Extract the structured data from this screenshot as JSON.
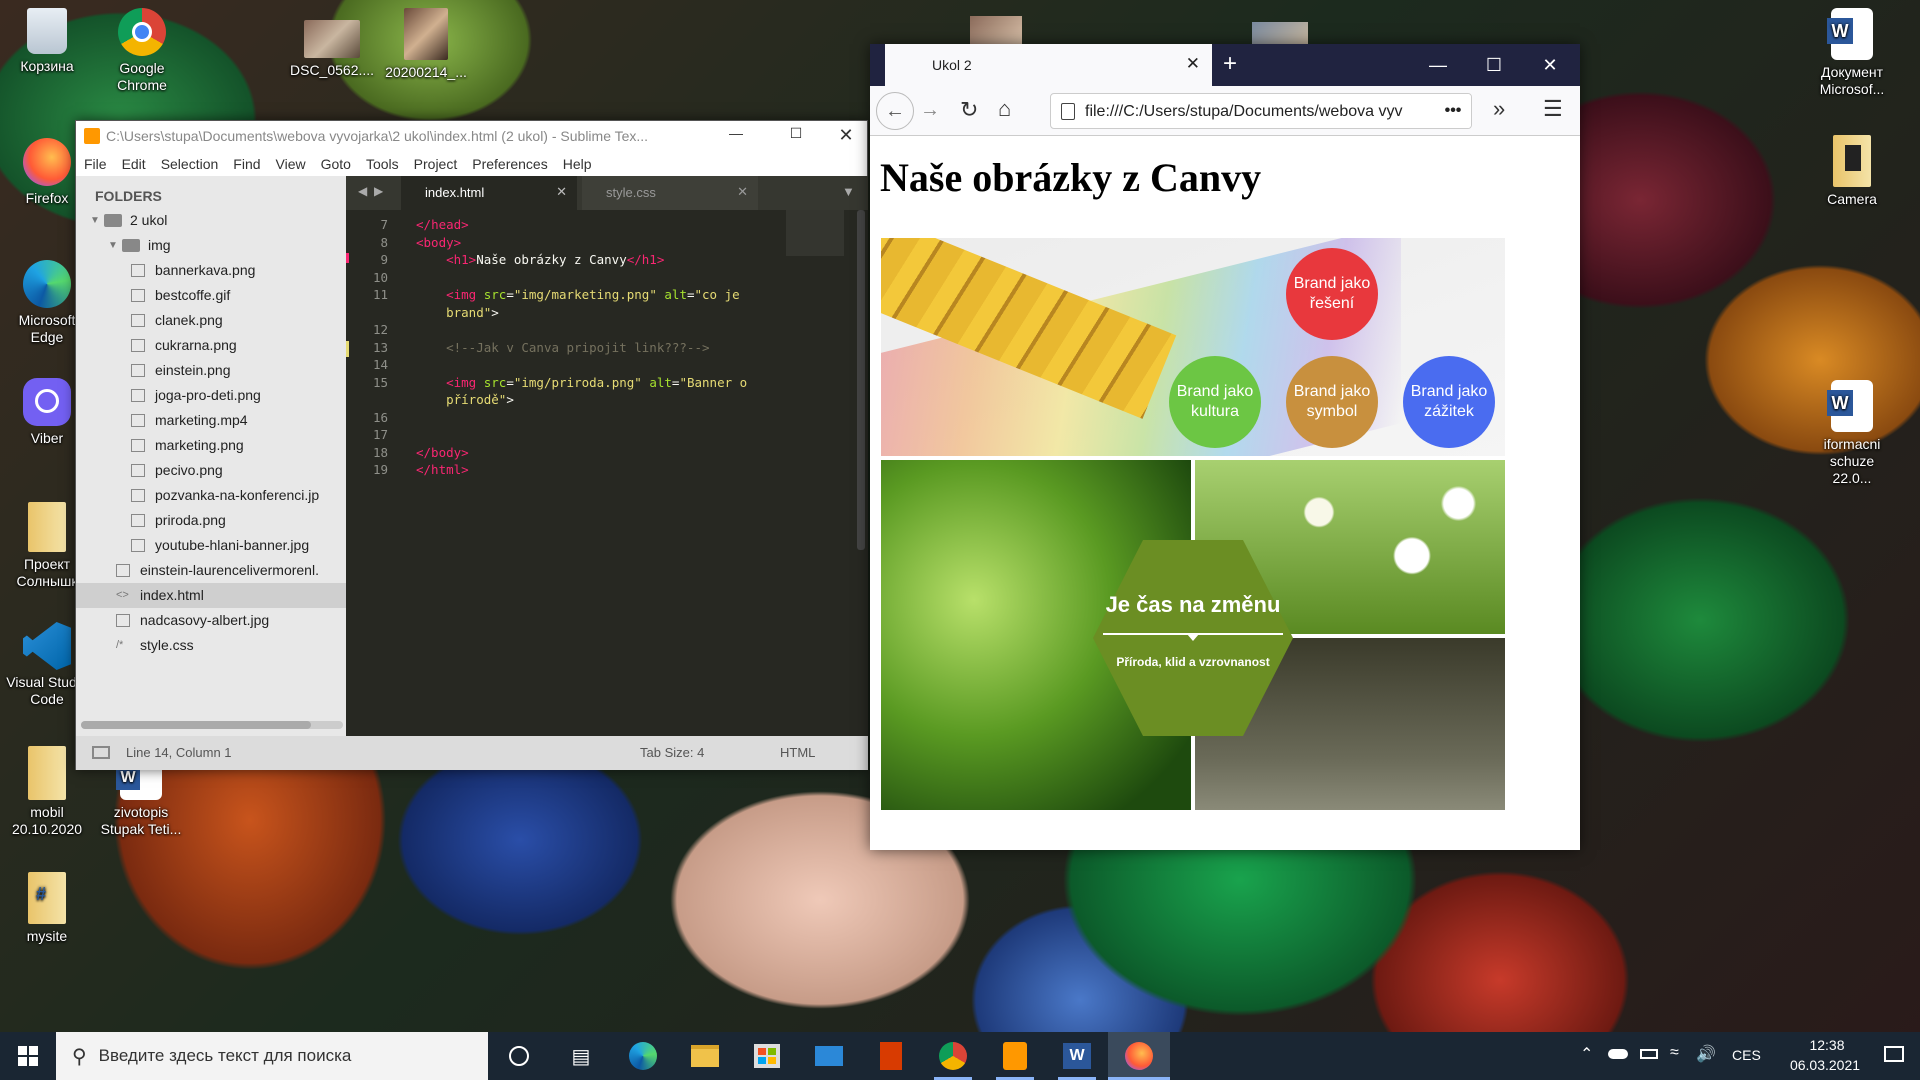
{
  "desktop": {
    "icons": [
      {
        "label": "Корзина",
        "sub": ""
      },
      {
        "label": "Google Chrome",
        "sub": ""
      },
      {
        "label": "DSC_0562....",
        "sub": ""
      },
      {
        "label": "20200214_...",
        "sub": ""
      },
      {
        "label": "Firefox",
        "sub": ""
      },
      {
        "label": "Microsoft Edge",
        "sub": ""
      },
      {
        "label": "Viber",
        "sub": ""
      },
      {
        "label": "Проект Солнышк",
        "sub": ""
      },
      {
        "label": "Visual Studio Code",
        "sub": ""
      },
      {
        "label": "mobil 20.10.2020",
        "sub": ""
      },
      {
        "label": "zivotopis Stupak Teti...",
        "sub": ""
      },
      {
        "label": "mysite",
        "sub": ""
      },
      {
        "label": "Документ Microsof...",
        "sub": ""
      },
      {
        "label": "Camera",
        "sub": ""
      },
      {
        "label": "iformacni schuze 22.0...",
        "sub": ""
      }
    ]
  },
  "sublime": {
    "title": "C:\\Users\\stupa\\Documents\\webova vyvojarka\\2 ukol\\index.html (2 ukol) - Sublime Tex...",
    "menu": [
      "File",
      "Edit",
      "Selection",
      "Find",
      "View",
      "Goto",
      "Tools",
      "Project",
      "Preferences",
      "Help"
    ],
    "folders_header": "FOLDERS",
    "tree": [
      {
        "name": "2 ukol",
        "indent": 1,
        "type": "folder"
      },
      {
        "name": "img",
        "indent": 2,
        "type": "folder"
      },
      {
        "name": "bannerkava.png",
        "indent": 3,
        "type": "img"
      },
      {
        "name": "bestcoffe.gif",
        "indent": 3,
        "type": "img"
      },
      {
        "name": "clanek.png",
        "indent": 3,
        "type": "img"
      },
      {
        "name": "cukrarna.png",
        "indent": 3,
        "type": "img"
      },
      {
        "name": "einstein.png",
        "indent": 3,
        "type": "img"
      },
      {
        "name": "joga-pro-deti.png",
        "indent": 3,
        "type": "img"
      },
      {
        "name": "marketing.mp4",
        "indent": 3,
        "type": "file"
      },
      {
        "name": "marketing.png",
        "indent": 3,
        "type": "img"
      },
      {
        "name": "pecivo.png",
        "indent": 3,
        "type": "img"
      },
      {
        "name": "pozvanka-na-konferenci.jp",
        "indent": 3,
        "type": "img"
      },
      {
        "name": "priroda.png",
        "indent": 3,
        "type": "img"
      },
      {
        "name": "youtube-hlani-banner.jpg",
        "indent": 3,
        "type": "img"
      },
      {
        "name": "einstein-laurencelivermorenl.",
        "indent": 2,
        "type": "img"
      },
      {
        "name": "index.html",
        "indent": 2,
        "type": "code",
        "selected": true
      },
      {
        "name": "nadcasovy-albert.jpg",
        "indent": 2,
        "type": "img"
      },
      {
        "name": "style.css",
        "indent": 2,
        "type": "css"
      }
    ],
    "tabs": [
      {
        "label": "index.html",
        "active": true
      },
      {
        "label": "style.css",
        "active": false
      }
    ],
    "code_lines": [
      {
        "n": "7",
        "html": "<span class=\"tg\">&lt;/</span><span class=\"tg\">head</span><span class=\"tg\">&gt;</span>"
      },
      {
        "n": "8",
        "html": "<span class=\"tg\">&lt;body&gt;</span>"
      },
      {
        "n": "9",
        "html": "    <span class=\"tg\">&lt;h1&gt;</span>Naše obrázky z Canvy<span class=\"tg\">&lt;/h1&gt;</span>"
      },
      {
        "n": "10",
        "html": ""
      },
      {
        "n": "11",
        "html": "    <span class=\"tg\">&lt;img</span> <span class=\"at\">src</span>=<span class=\"st\">\"img/marketing.png\"</span> <span class=\"at\">alt</span>=<span class=\"st\">\"co je</span>"
      },
      {
        "n": "",
        "html": "    <span class=\"st\">brand\"</span>&gt;"
      },
      {
        "n": "12",
        "html": ""
      },
      {
        "n": "13",
        "html": "    <span class=\"cm\">&lt;!--Jak v Canva pripojit link???--&gt;</span>"
      },
      {
        "n": "14",
        "html": ""
      },
      {
        "n": "15",
        "html": "    <span class=\"tg\">&lt;img</span> <span class=\"at\">src</span>=<span class=\"st\">\"img/priroda.png\"</span> <span class=\"at\">alt</span>=<span class=\"st\">\"Banner o</span>"
      },
      {
        "n": "",
        "html": "    <span class=\"st\">přírodě\"</span>&gt;"
      },
      {
        "n": "16",
        "html": ""
      },
      {
        "n": "17",
        "html": ""
      },
      {
        "n": "18",
        "html": "<span class=\"tg\">&lt;/body&gt;</span>"
      },
      {
        "n": "19",
        "html": "<span class=\"tg\">&lt;/html&gt;</span>"
      }
    ],
    "status_left": "Line 14, Column 1",
    "status_tab": "Tab Size: 4",
    "status_syntax": "HTML"
  },
  "firefox": {
    "tab_title": "Ukol 2",
    "url": "file:///C:/Users/stupa/Documents/webova vyv",
    "page_heading": "Naše obrázky z Canvy",
    "banner1": {
      "circles": [
        {
          "label": "Brand jako řešení",
          "color": "#e8383d"
        },
        {
          "label": "Brand jako kultura",
          "color": "#6cc644"
        },
        {
          "label": "Brand jako symbol",
          "color": "#c8903e"
        },
        {
          "label": "Brand jako zážitek",
          "color": "#4a6cf0"
        }
      ]
    },
    "banner2": {
      "title": "Je čas na změnu",
      "subtitle": "Příroda, klid a vzrovnanost"
    }
  },
  "taskbar": {
    "search_placeholder": "Введите здесь текст для поиска",
    "lang": "CES",
    "time": "12:38",
    "date": "06.03.2021"
  }
}
